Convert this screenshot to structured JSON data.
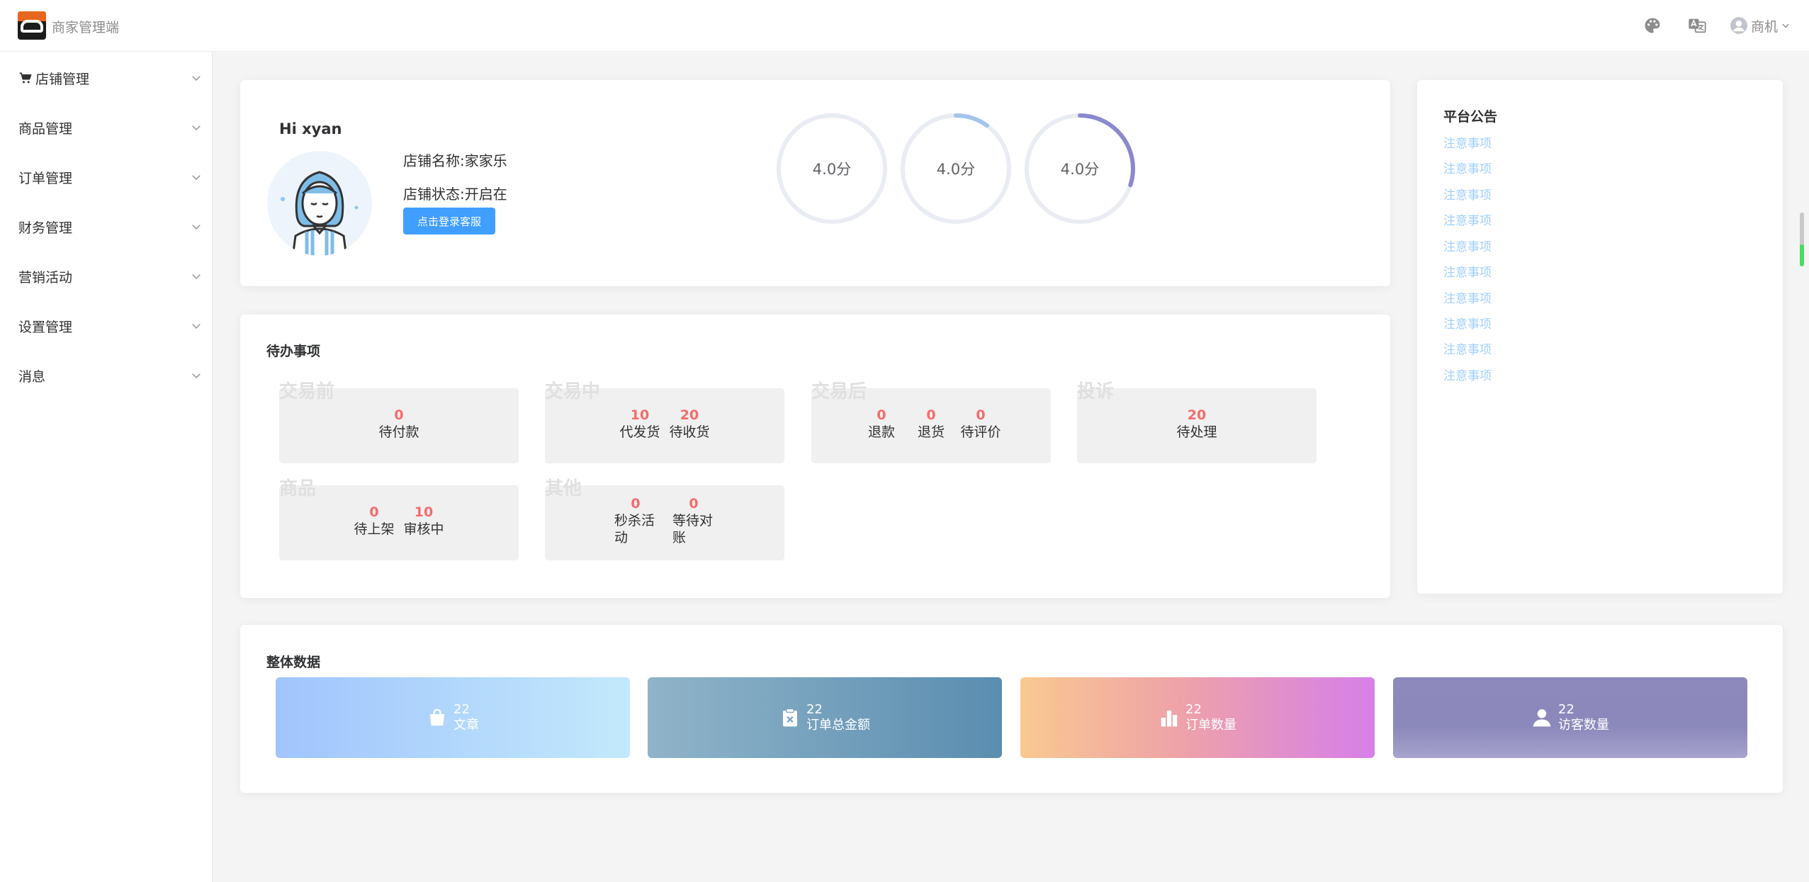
{
  "header": {
    "brand": "商家管理端",
    "user_label": "商机",
    "icons": [
      "palette-icon",
      "translate-icon",
      "user-icon"
    ]
  },
  "sidebar": {
    "items": [
      {
        "label": "店铺管理",
        "icon": "cart-icon"
      },
      {
        "label": "商品管理"
      },
      {
        "label": "订单管理"
      },
      {
        "label": "财务管理"
      },
      {
        "label": "营销活动"
      },
      {
        "label": "设置管理"
      },
      {
        "label": "消息"
      }
    ]
  },
  "profile": {
    "greeting": "Hi xyan",
    "shop_name": "店铺名称:家家乐",
    "shop_status": "店铺状态:开启在",
    "service_button": "点击登录客服",
    "ratings": [
      {
        "label": "4.0分",
        "progress": 0.0,
        "color": "#e9ecf2"
      },
      {
        "label": "4.0分",
        "progress": 0.1,
        "color": "#a3c4ec"
      },
      {
        "label": "4.0分",
        "progress": 0.3,
        "color": "#8a89cf"
      }
    ]
  },
  "todo": {
    "title": "待办事项",
    "groups": [
      {
        "category": "交易前",
        "items": [
          {
            "num": "0",
            "label": "待付款"
          }
        ]
      },
      {
        "category": "交易中",
        "items": [
          {
            "num": "10",
            "label": "代发货"
          },
          {
            "num": "20",
            "label": "待收货"
          }
        ]
      },
      {
        "category": "交易后",
        "items": [
          {
            "num": "0",
            "label": "退款"
          },
          {
            "num": "0",
            "label": "退货"
          },
          {
            "num": "0",
            "label": "待评价"
          }
        ]
      },
      {
        "category": "投诉",
        "items": [
          {
            "num": "20",
            "label": "待处理"
          }
        ]
      },
      {
        "category": "商品",
        "items": [
          {
            "num": "0",
            "label": "待上架"
          },
          {
            "num": "10",
            "label": "审核中"
          }
        ]
      },
      {
        "category": "其他",
        "items": [
          {
            "num": "0",
            "label": "秒杀活动"
          },
          {
            "num": "0",
            "label": "等待对账"
          }
        ]
      }
    ]
  },
  "notices": {
    "title": "平台公告",
    "items": [
      "注意事项",
      "注意事项",
      "注意事项",
      "注意事项",
      "注意事项",
      "注意事项",
      "注意事项",
      "注意事项",
      "注意事项",
      "注意事项"
    ]
  },
  "overall": {
    "title": "整体数据",
    "stats": [
      {
        "value": "22",
        "label": "文章",
        "icon": "shopping-bag-icon"
      },
      {
        "value": "22",
        "label": "订单总金额",
        "icon": "clipboard-x-icon"
      },
      {
        "value": "22",
        "label": "订单数量",
        "icon": "bar-chart-icon"
      },
      {
        "value": "22",
        "label": "访客数量",
        "icon": "user-icon"
      }
    ]
  }
}
